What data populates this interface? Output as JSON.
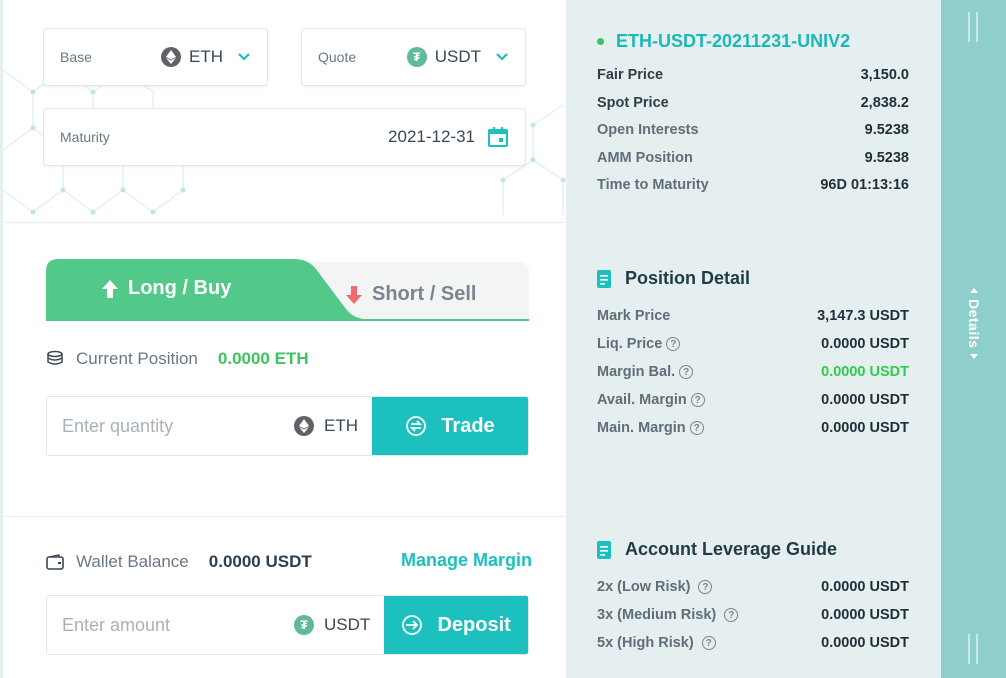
{
  "selectors": {
    "base": {
      "label": "Base",
      "value": "ETH",
      "icon": "ethereum-icon"
    },
    "quote": {
      "label": "Quote",
      "value": "USDT",
      "icon": "tether-icon"
    },
    "maturity": {
      "label": "Maturity",
      "value": "2021-12-31",
      "icon": "calendar-icon"
    }
  },
  "trade_tabs": {
    "long_label": "Long / Buy",
    "short_label": "Short / Sell",
    "active": "long"
  },
  "position": {
    "label": "Current Position",
    "value": "0.0000 ETH",
    "quantity_placeholder": "Enter quantity",
    "unit": "ETH",
    "trade_button": "Trade"
  },
  "wallet": {
    "label": "Wallet Balance",
    "value": "0.0000 USDT",
    "manage_link": "Manage Margin",
    "amount_placeholder": "Enter amount",
    "unit": "USDT",
    "deposit_button": "Deposit"
  },
  "market": {
    "name": "ETH-USDT-20211231-UNIV2",
    "rows": [
      {
        "label": "Fair Price",
        "value": "3,150.0"
      },
      {
        "label": "Spot Price",
        "value": "2,838.2"
      },
      {
        "label": "Open Interests",
        "value": "9.5238"
      },
      {
        "label": "AMM Position",
        "value": "9.5238"
      },
      {
        "label": "Time to Maturity",
        "value": "96D 01:13:16"
      }
    ]
  },
  "position_detail": {
    "title": "Position Detail",
    "rows": [
      {
        "label": "Mark Price",
        "value": "3,147.3 USDT",
        "help": false
      },
      {
        "label": "Liq. Price",
        "value": "0.0000 USDT",
        "help": true
      },
      {
        "label": "Margin Bal.",
        "value": "0.0000 USDT",
        "help": true,
        "color": "#2fcc4a"
      },
      {
        "label": "Avail. Margin",
        "value": "0.0000 USDT",
        "help": true
      },
      {
        "label": "Main. Margin",
        "value": "0.0000 USDT",
        "help": true
      }
    ]
  },
  "leverage_guide": {
    "title": "Account Leverage Guide",
    "rows": [
      {
        "label": "2x (Low Risk)",
        "value": "0.0000 USDT"
      },
      {
        "label": "3x (Medium Risk)",
        "value": "0.0000 USDT"
      },
      {
        "label": "5x (High Risk)",
        "value": "0.0000 USDT"
      }
    ]
  },
  "details_panel": {
    "label": "Details"
  },
  "colors": {
    "accent": "#1cc0bf",
    "long_green": "#52c989",
    "short_red": "#f06b6b",
    "positive": "#3dc45c",
    "panel_bg": "#e6efef",
    "strip_bg": "#8ecfcc"
  }
}
